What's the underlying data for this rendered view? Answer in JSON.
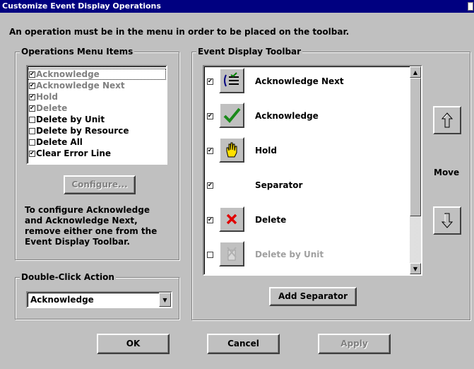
{
  "window": {
    "title": "Customize Event Display Operations"
  },
  "intro_text": "An operation must be in the menu in order to be placed on the toolbar.",
  "ops_menu": {
    "title": "Operations Menu Items",
    "items": [
      {
        "label": "Acknowledge",
        "checked": true,
        "gray": true
      },
      {
        "label": "Acknowledge Next",
        "checked": true,
        "gray": true
      },
      {
        "label": "Hold",
        "checked": true,
        "gray": true
      },
      {
        "label": "Delete",
        "checked": true,
        "gray": true
      },
      {
        "label": "Delete by Unit",
        "checked": false,
        "gray": false
      },
      {
        "label": "Delete by Resource",
        "checked": false,
        "gray": false
      },
      {
        "label": "Delete All",
        "checked": false,
        "gray": false
      },
      {
        "label": "Clear Error Line",
        "checked": true,
        "gray": false
      }
    ],
    "configure_label": "Configure...",
    "note_lines": [
      "To configure Acknowledge",
      "and Acknowledge Next,",
      "remove either one from the",
      "Event Display Toolbar."
    ]
  },
  "double_click": {
    "title": "Double-Click Action",
    "value": "Acknowledge"
  },
  "toolbar": {
    "title": "Event Display Toolbar",
    "items": [
      {
        "label": "Acknowledge Next",
        "checked": true,
        "icon": "acknowledge-next-icon"
      },
      {
        "label": "Acknowledge",
        "checked": true,
        "icon": "checkmark-icon"
      },
      {
        "label": "Hold",
        "checked": true,
        "icon": "hand-icon"
      },
      {
        "label": "Separator",
        "checked": true,
        "icon": ""
      },
      {
        "label": "Delete",
        "checked": true,
        "icon": "red-x-icon"
      },
      {
        "label": "Delete by Unit",
        "checked": false,
        "icon": "delete-by-unit-icon"
      }
    ],
    "add_separator_label": "Add Separator",
    "move_label": "Move"
  },
  "buttons": {
    "ok": "OK",
    "cancel": "Cancel",
    "apply": "Apply"
  },
  "colors": {
    "title_bar": "#000080",
    "face": "#c0c0c0",
    "check_green": "#008000",
    "delete_red": "#e00000"
  }
}
